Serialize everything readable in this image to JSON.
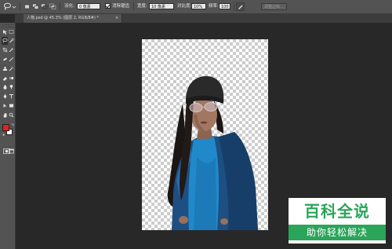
{
  "options_bar": {
    "feather_label": "羽化:",
    "feather_value": "0 像素",
    "anti_alias_label": "消除锯齿",
    "width_label": "宽度:",
    "width_value": "10 像素",
    "contrast_label": "对比度:",
    "contrast_value": "10%",
    "frequency_label": "频率:",
    "frequency_value": "100",
    "refine_edge_label": "调整边缘..."
  },
  "document_tab": {
    "title": "人物.psd @ 45.3% (图层 2, RGB/8#) *",
    "close": "×"
  },
  "tools": [
    {
      "name": "move-tool-icon",
      "active": false
    },
    {
      "name": "marquee-tool-icon",
      "active": false
    },
    {
      "name": "lasso-tool-icon",
      "active": true
    },
    {
      "name": "quick-select-tool-icon",
      "active": false
    },
    {
      "name": "crop-tool-icon",
      "active": false
    },
    {
      "name": "eyedropper-tool-icon",
      "active": false
    },
    {
      "name": "healing-brush-icon",
      "active": false
    },
    {
      "name": "brush-tool-icon",
      "active": false
    },
    {
      "name": "clone-stamp-icon",
      "active": false
    },
    {
      "name": "history-brush-icon",
      "active": false
    },
    {
      "name": "eraser-tool-icon",
      "active": false
    },
    {
      "name": "gradient-tool-icon",
      "active": false
    },
    {
      "name": "blur-tool-icon",
      "active": false
    },
    {
      "name": "dodge-tool-icon",
      "active": false
    },
    {
      "name": "pen-tool-icon",
      "active": false
    },
    {
      "name": "type-tool-icon",
      "active": false
    },
    {
      "name": "path-select-icon",
      "active": false
    },
    {
      "name": "shape-tool-icon",
      "active": false
    },
    {
      "name": "hand-tool-icon",
      "active": false
    },
    {
      "name": "zoom-tool-icon",
      "active": false
    }
  ],
  "colors": {
    "foreground": "#e52020",
    "background": "#ffffff",
    "watermark_green": "#2aa55a"
  },
  "watermark": {
    "title": "百科全说",
    "subtitle": "助你轻松解决"
  }
}
